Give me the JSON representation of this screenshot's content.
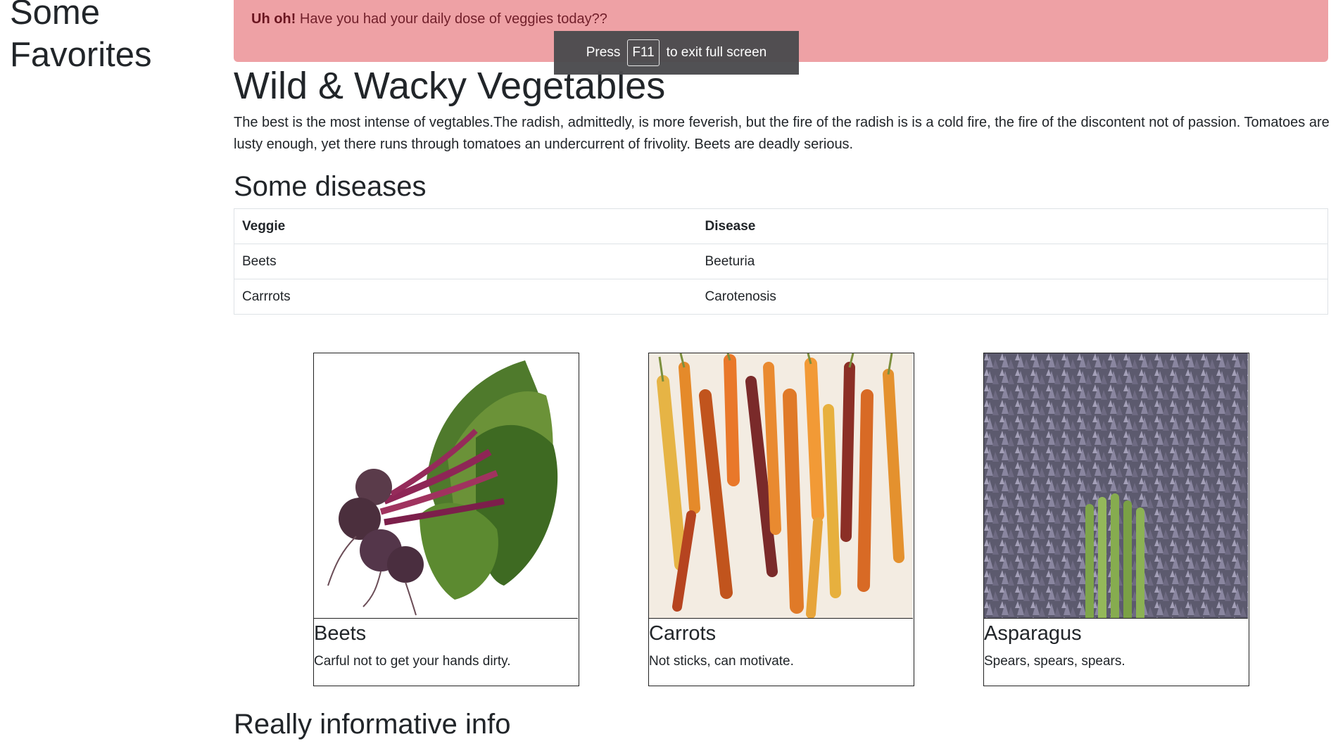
{
  "sidebar": {
    "title": "Some Favorites"
  },
  "alert": {
    "strong": "Uh oh!",
    "message": " Have you had your daily dose of veggies today??",
    "background": "#eea1a5"
  },
  "fullscreen_notice": {
    "press": "Press",
    "key": "F11",
    "suffix": "to exit full screen"
  },
  "main": {
    "heading": "Wild & Wacky Vegetables",
    "intro": "The best is the most intense of vegtables.The radish, admittedly, is more feverish, but the fire of the radish is is a cold fire, the fire of the discontent not of passion. Tomatoes are lusty enough, yet there runs through tomatoes an undercurrent of frivolity. Beets are deadly serious.",
    "diseases_heading": "Some diseases",
    "table": {
      "headers": [
        "Veggie",
        "Disease"
      ],
      "rows": [
        [
          "Beets",
          "Beeturia"
        ],
        [
          "Carrrots",
          "Carotenosis"
        ]
      ]
    },
    "cards": [
      {
        "title": "Beets",
        "text": "Carful not to get your hands dirty.",
        "icon": "beets-image"
      },
      {
        "title": "Carrots",
        "text": "Not sticks, can motivate.",
        "icon": "carrots-image"
      },
      {
        "title": "Asparagus",
        "text": "Spears, spears, spears.",
        "icon": "asparagus-image"
      }
    ],
    "info_heading": "Really informative info"
  }
}
